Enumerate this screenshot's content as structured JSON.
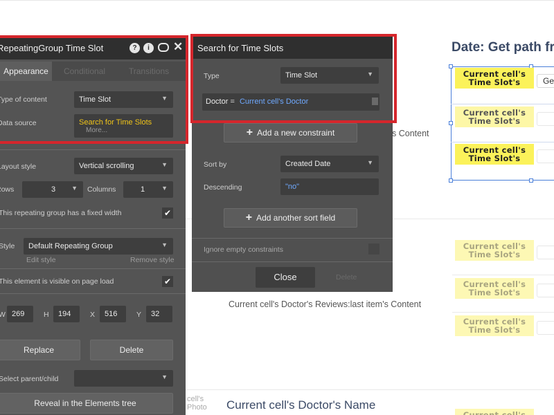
{
  "canvas": {
    "date_title": "Date: Get path fro",
    "cell_text": "Current cell's Time Slot's",
    "cell_text_extra": "Time Slot's",
    "get_button": "Ge",
    "content_label": "s Content",
    "reviews_label": "Current cell's Doctor's Reviews:last item's Content",
    "doctor_name": "Current cell's Doctor's Name",
    "photo_label_1": "cell's",
    "photo_label_2": "Photo"
  },
  "element_panel": {
    "title": "RepeatingGroup Time Slot",
    "header_icons": [
      "help-icon",
      "info-icon",
      "comment-icon",
      "close-icon"
    ],
    "tabs": [
      "Appearance",
      "Conditional",
      "Transitions"
    ],
    "type_of_content_label": "Type of content",
    "type_of_content_value": "Time Slot",
    "data_source_label": "Data source",
    "data_source_value": "Search for Time Slots",
    "data_source_more": "More...",
    "layout_style_label": "Layout style",
    "layout_style_value": "Vertical scrolling",
    "rows_label": "Rows",
    "rows_value": "3",
    "columns_label": "Columns",
    "columns_value": "1",
    "fixed_width_label": "This repeating group has a fixed width",
    "style_label": "Style",
    "style_value": "Default Repeating Group",
    "edit_style": "Edit style",
    "remove_style": "Remove style",
    "visible_label": "This element is visible on page load",
    "w_label": "W",
    "w_value": "269",
    "h_label": "H",
    "h_value": "194",
    "x_label": "X",
    "x_value": "516",
    "y_label": "Y",
    "y_value": "32",
    "replace_button": "Replace",
    "delete_button": "Delete",
    "select_parent_label": "Select parent/child",
    "reveal_button": "Reveal in the Elements tree"
  },
  "search_panel": {
    "title": "Search for Time Slots",
    "type_label": "Type",
    "type_value": "Time Slot",
    "constraint_key": "Doctor =",
    "constraint_value": "Current cell's Doctor",
    "add_constraint": "Add a new constraint",
    "sort_by_label": "Sort by",
    "sort_by_value": "Created Date",
    "descending_label": "Descending",
    "descending_value": "\"no\"",
    "add_sort": "Add another sort field",
    "ignore_empty_label": "Ignore empty constraints",
    "close_button": "Close",
    "delete_button": "Delete"
  },
  "colors": {
    "highlight_red": "#d5262c",
    "dynamic_yellow": "#f0c419",
    "dynamic_blue": "#6fa9ff",
    "panel_bg": "#545454",
    "header_bg": "#2f2f2f"
  }
}
